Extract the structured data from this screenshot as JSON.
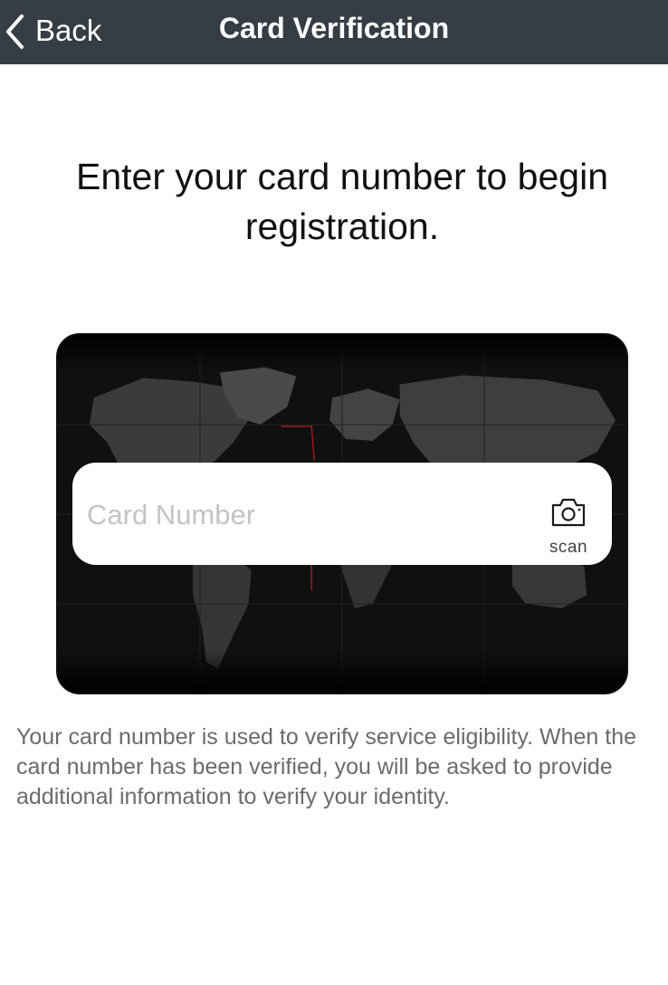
{
  "navbar": {
    "back_label": "Back",
    "title": "Card Verification"
  },
  "main": {
    "headline": "Enter your card number to begin registration.",
    "card_field": {
      "placeholder": "Card Number",
      "value": "",
      "scan_label": "scan"
    },
    "description": "Your card number is used to verify service eligibility. When the card number has been verified, you will be asked to provide additional information to verify your identity."
  },
  "icons": {
    "back": "chevron-left-icon",
    "scan": "camera-icon"
  },
  "colors": {
    "navbar_bg": "#363d44",
    "card_bg": "#050505",
    "placeholder": "#c4c4c8",
    "description_text": "#6b6b6b"
  }
}
